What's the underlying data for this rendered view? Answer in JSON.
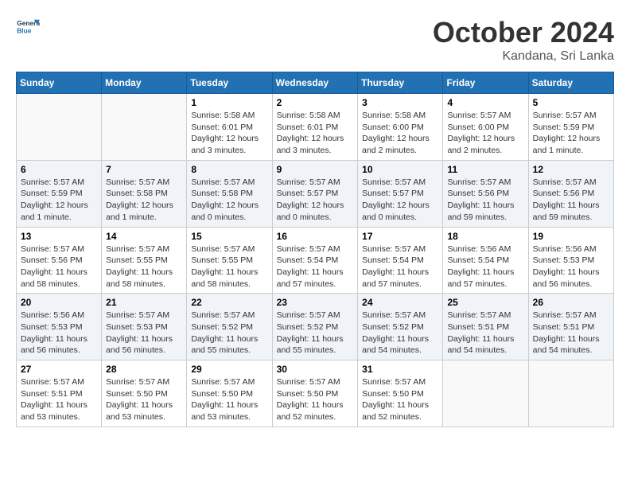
{
  "header": {
    "logo": "GeneralBlue",
    "title": "October 2024",
    "location": "Kandana, Sri Lanka"
  },
  "days_of_week": [
    "Sunday",
    "Monday",
    "Tuesday",
    "Wednesday",
    "Thursday",
    "Friday",
    "Saturday"
  ],
  "weeks": [
    [
      {
        "day": "",
        "info": ""
      },
      {
        "day": "",
        "info": ""
      },
      {
        "day": "1",
        "sunrise": "5:58 AM",
        "sunset": "6:01 PM",
        "daylight": "12 hours and 3 minutes."
      },
      {
        "day": "2",
        "sunrise": "5:58 AM",
        "sunset": "6:01 PM",
        "daylight": "12 hours and 3 minutes."
      },
      {
        "day": "3",
        "sunrise": "5:58 AM",
        "sunset": "6:00 PM",
        "daylight": "12 hours and 2 minutes."
      },
      {
        "day": "4",
        "sunrise": "5:57 AM",
        "sunset": "6:00 PM",
        "daylight": "12 hours and 2 minutes."
      },
      {
        "day": "5",
        "sunrise": "5:57 AM",
        "sunset": "5:59 PM",
        "daylight": "12 hours and 1 minute."
      }
    ],
    [
      {
        "day": "6",
        "sunrise": "5:57 AM",
        "sunset": "5:59 PM",
        "daylight": "12 hours and 1 minute."
      },
      {
        "day": "7",
        "sunrise": "5:57 AM",
        "sunset": "5:58 PM",
        "daylight": "12 hours and 1 minute."
      },
      {
        "day": "8",
        "sunrise": "5:57 AM",
        "sunset": "5:58 PM",
        "daylight": "12 hours and 0 minutes."
      },
      {
        "day": "9",
        "sunrise": "5:57 AM",
        "sunset": "5:57 PM",
        "daylight": "12 hours and 0 minutes."
      },
      {
        "day": "10",
        "sunrise": "5:57 AM",
        "sunset": "5:57 PM",
        "daylight": "12 hours and 0 minutes."
      },
      {
        "day": "11",
        "sunrise": "5:57 AM",
        "sunset": "5:56 PM",
        "daylight": "11 hours and 59 minutes."
      },
      {
        "day": "12",
        "sunrise": "5:57 AM",
        "sunset": "5:56 PM",
        "daylight": "11 hours and 59 minutes."
      }
    ],
    [
      {
        "day": "13",
        "sunrise": "5:57 AM",
        "sunset": "5:56 PM",
        "daylight": "11 hours and 58 minutes."
      },
      {
        "day": "14",
        "sunrise": "5:57 AM",
        "sunset": "5:55 PM",
        "daylight": "11 hours and 58 minutes."
      },
      {
        "day": "15",
        "sunrise": "5:57 AM",
        "sunset": "5:55 PM",
        "daylight": "11 hours and 58 minutes."
      },
      {
        "day": "16",
        "sunrise": "5:57 AM",
        "sunset": "5:54 PM",
        "daylight": "11 hours and 57 minutes."
      },
      {
        "day": "17",
        "sunrise": "5:57 AM",
        "sunset": "5:54 PM",
        "daylight": "11 hours and 57 minutes."
      },
      {
        "day": "18",
        "sunrise": "5:56 AM",
        "sunset": "5:54 PM",
        "daylight": "11 hours and 57 minutes."
      },
      {
        "day": "19",
        "sunrise": "5:56 AM",
        "sunset": "5:53 PM",
        "daylight": "11 hours and 56 minutes."
      }
    ],
    [
      {
        "day": "20",
        "sunrise": "5:56 AM",
        "sunset": "5:53 PM",
        "daylight": "11 hours and 56 minutes."
      },
      {
        "day": "21",
        "sunrise": "5:57 AM",
        "sunset": "5:53 PM",
        "daylight": "11 hours and 56 minutes."
      },
      {
        "day": "22",
        "sunrise": "5:57 AM",
        "sunset": "5:52 PM",
        "daylight": "11 hours and 55 minutes."
      },
      {
        "day": "23",
        "sunrise": "5:57 AM",
        "sunset": "5:52 PM",
        "daylight": "11 hours and 55 minutes."
      },
      {
        "day": "24",
        "sunrise": "5:57 AM",
        "sunset": "5:52 PM",
        "daylight": "11 hours and 54 minutes."
      },
      {
        "day": "25",
        "sunrise": "5:57 AM",
        "sunset": "5:51 PM",
        "daylight": "11 hours and 54 minutes."
      },
      {
        "day": "26",
        "sunrise": "5:57 AM",
        "sunset": "5:51 PM",
        "daylight": "11 hours and 54 minutes."
      }
    ],
    [
      {
        "day": "27",
        "sunrise": "5:57 AM",
        "sunset": "5:51 PM",
        "daylight": "11 hours and 53 minutes."
      },
      {
        "day": "28",
        "sunrise": "5:57 AM",
        "sunset": "5:50 PM",
        "daylight": "11 hours and 53 minutes."
      },
      {
        "day": "29",
        "sunrise": "5:57 AM",
        "sunset": "5:50 PM",
        "daylight": "11 hours and 53 minutes."
      },
      {
        "day": "30",
        "sunrise": "5:57 AM",
        "sunset": "5:50 PM",
        "daylight": "11 hours and 52 minutes."
      },
      {
        "day": "31",
        "sunrise": "5:57 AM",
        "sunset": "5:50 PM",
        "daylight": "11 hours and 52 minutes."
      },
      {
        "day": "",
        "info": ""
      },
      {
        "day": "",
        "info": ""
      }
    ]
  ]
}
